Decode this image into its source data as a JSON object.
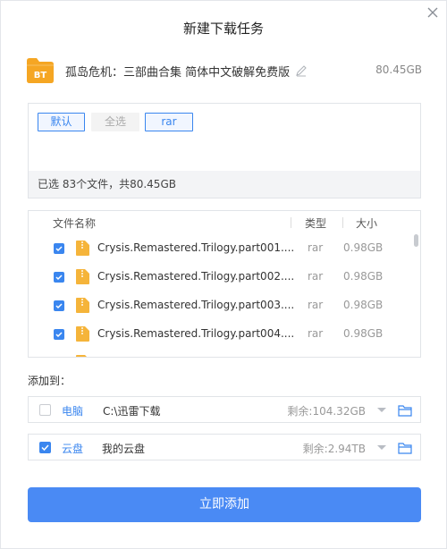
{
  "dialog": {
    "title": "新建下载任务",
    "close_icon": "close-icon"
  },
  "task": {
    "icon": "bt-file-icon",
    "icon_label": "BT",
    "name": "孤岛危机：三部曲合集 简体中文破解免费版",
    "edit_icon": "edit-pencil-icon",
    "size": "80.45GB"
  },
  "filters": {
    "chips": [
      {
        "label": "默认",
        "active": true
      },
      {
        "label": "全选",
        "active": false
      },
      {
        "label": "rar",
        "active": true
      }
    ],
    "summary": "已选 83个文件，共80.45GB"
  },
  "file_list": {
    "columns": {
      "name": "文件名称",
      "type": "类型",
      "size": "大小"
    },
    "rows": [
      {
        "checked": true,
        "name": "Crysis.Remastered.Trilogy.part001....",
        "type": "rar",
        "size": "0.98GB"
      },
      {
        "checked": true,
        "name": "Crysis.Remastered.Trilogy.part002....",
        "type": "rar",
        "size": "0.98GB"
      },
      {
        "checked": true,
        "name": "Crysis.Remastered.Trilogy.part003....",
        "type": "rar",
        "size": "0.98GB"
      },
      {
        "checked": true,
        "name": "Crysis.Remastered.Trilogy.part004....",
        "type": "rar",
        "size": "0.98GB"
      }
    ]
  },
  "destinations": {
    "heading": "添加到：",
    "items": [
      {
        "checked": false,
        "label": "电脑",
        "path": "C:\\迅雷下载",
        "free": "剩余:104.32GB"
      },
      {
        "checked": true,
        "label": "云盘",
        "path": "我的云盘",
        "free": "剩余:2.94TB"
      }
    ]
  },
  "actions": {
    "submit_label": "立即添加"
  },
  "colors": {
    "accent": "#4a8af4",
    "link_blue": "#3a86ef",
    "folder_orange": "#f5a623"
  }
}
